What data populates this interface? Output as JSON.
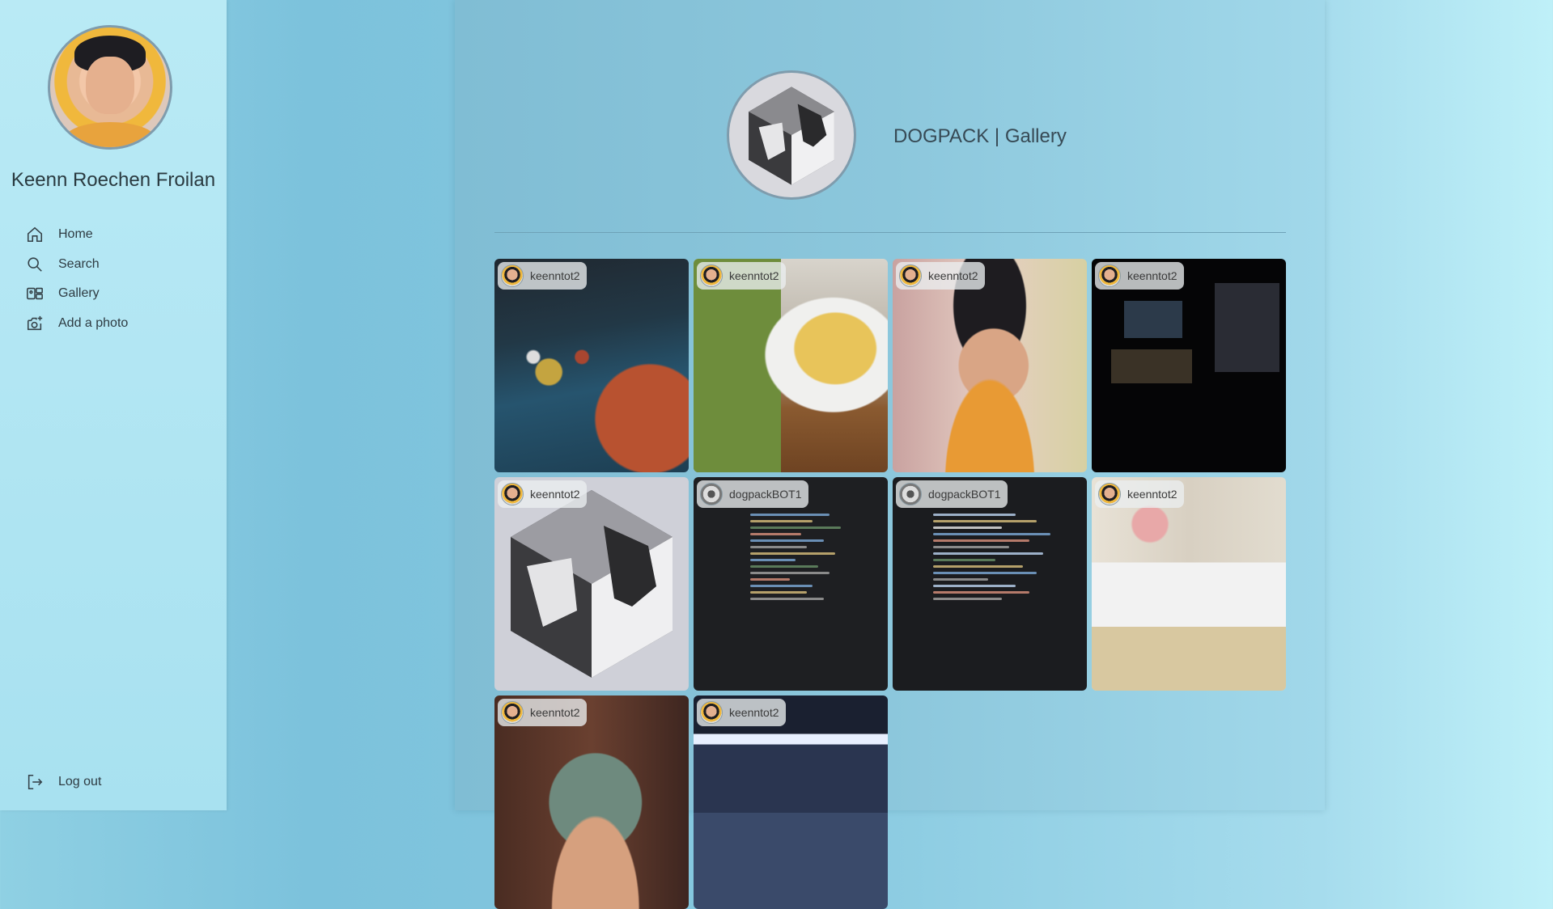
{
  "sidebar": {
    "user_name": "Keenn Roechen Froilan",
    "nav": [
      {
        "label": "Home",
        "icon": "home-icon"
      },
      {
        "label": "Search",
        "icon": "search-icon"
      },
      {
        "label": "Gallery",
        "icon": "gallery-icon"
      },
      {
        "label": "Add a photo",
        "icon": "add-photo-icon"
      }
    ],
    "logout": {
      "label": "Log out",
      "icon": "logout-icon"
    }
  },
  "header": {
    "title": "DOGPACK | Gallery"
  },
  "gallery": {
    "items": [
      {
        "author": "keenntot2",
        "photo": "billiards-photo"
      },
      {
        "author": "keenntot2",
        "photo": "food-drink-photo"
      },
      {
        "author": "keenntot2",
        "photo": "selfie-orange-shirt-photo"
      },
      {
        "author": "keenntot2",
        "photo": "dark-monitors-photo"
      },
      {
        "author": "keenntot2",
        "photo": "dogpack-logo-photo"
      },
      {
        "author": "dogpackBOT1",
        "photo": "code-editor-css-photo"
      },
      {
        "author": "dogpackBOT1",
        "photo": "code-editor-python-photo"
      },
      {
        "author": "keenntot2",
        "photo": "group-photo"
      },
      {
        "author": "keenntot2",
        "photo": "cap-selfie-photo"
      },
      {
        "author": "keenntot2",
        "photo": "group-night-photo"
      }
    ]
  },
  "colors": {
    "sidebar_bg": "#b2e6f3",
    "main_panel_bg": "#8cc7dc",
    "text": "#2e3b42"
  }
}
